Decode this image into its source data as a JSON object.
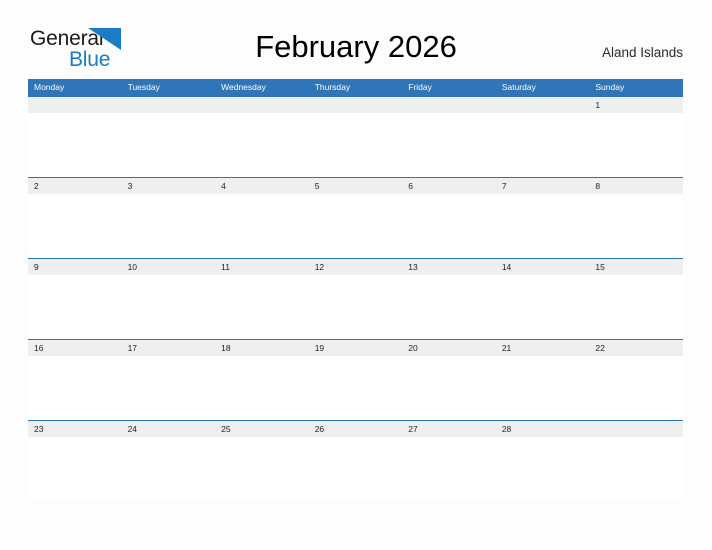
{
  "brand": {
    "name_part1": "General",
    "name_part2": "Blue",
    "triangle_icon": "blue-triangle-logo-icon",
    "color_dark": "#1b1b1b",
    "color_blue": "#1a7cc4"
  },
  "header": {
    "title": "February 2026",
    "region": "Aland Islands"
  },
  "calendar": {
    "accent_color": "#3075b8",
    "divider_color": "#2e74b5",
    "band_color": "#efeff0",
    "weekdays": [
      "Monday",
      "Tuesday",
      "Wednesday",
      "Thursday",
      "Friday",
      "Saturday",
      "Sunday"
    ],
    "weeks": [
      [
        "",
        "",
        "",
        "",
        "",
        "",
        "1"
      ],
      [
        "2",
        "3",
        "4",
        "5",
        "6",
        "7",
        "8"
      ],
      [
        "9",
        "10",
        "11",
        "12",
        "13",
        "14",
        "15"
      ],
      [
        "16",
        "17",
        "18",
        "19",
        "20",
        "21",
        "22"
      ],
      [
        "23",
        "24",
        "25",
        "26",
        "27",
        "28",
        ""
      ]
    ]
  }
}
